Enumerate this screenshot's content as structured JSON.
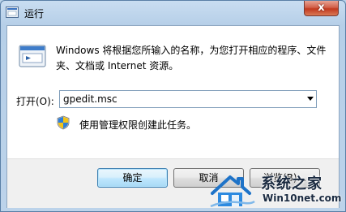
{
  "window": {
    "title": "运行",
    "close_label": "x",
    "app_icon": "run-dialog-icon"
  },
  "dialog": {
    "icon": "run-icon",
    "description": "Windows 将根据您所输入的名称，为您打开相应的程序、文件夹、文档或 Internet 资源。",
    "open_label": "打开(O):",
    "open_value": "gpedit.msc",
    "admin_icon": "uac-shield-icon",
    "admin_note": "使用管理权限创建此任务。"
  },
  "buttons": {
    "ok": "确定",
    "cancel": "取消",
    "browse": "浏览(B)..."
  },
  "watermark": {
    "title": "系统之家",
    "url": "Win10net.com"
  }
}
